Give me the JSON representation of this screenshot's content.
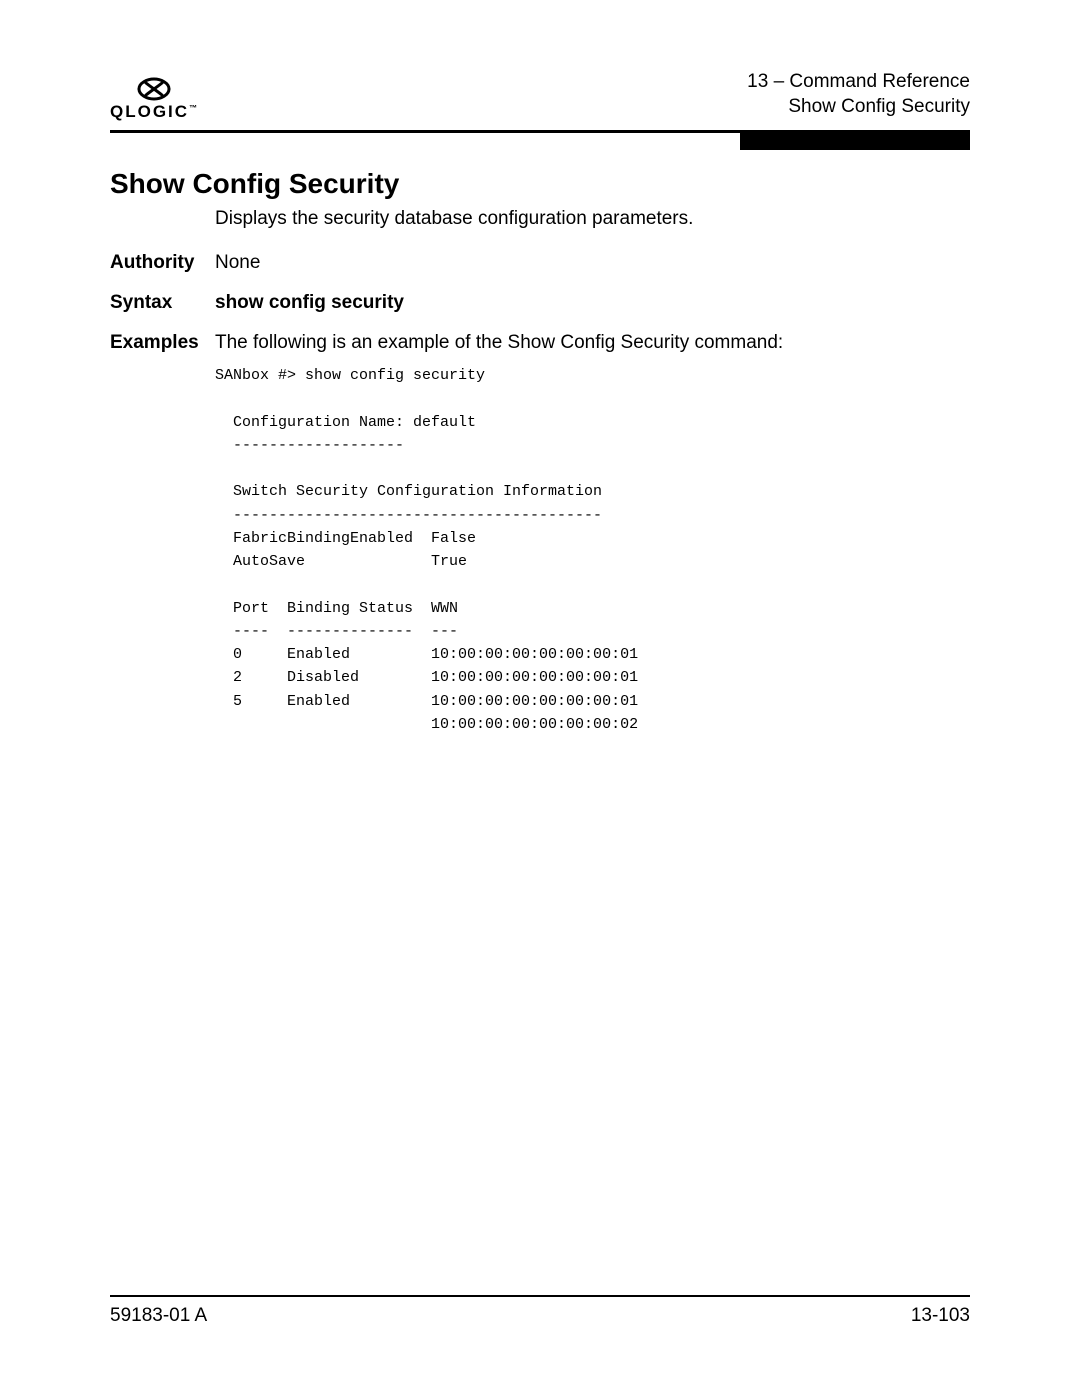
{
  "header": {
    "chapter_line": "13 – Command Reference",
    "section_line": "Show Config Security",
    "logo_text": "QLOGIC"
  },
  "title": "Show Config Security",
  "subtitle": "Displays the security database configuration parameters.",
  "authority": {
    "label": "Authority",
    "value": "None"
  },
  "syntax": {
    "label": "Syntax",
    "value": "show config security"
  },
  "examples": {
    "label": "Examples",
    "intro": "The following is an example of the Show Config Security command:",
    "terminal": "SANbox #> show config security\n\n  Configuration Name: default\n  -------------------\n\n  Switch Security Configuration Information\n  -----------------------------------------\n  FabricBindingEnabled  False\n  AutoSave              True\n\n  Port  Binding Status  WWN\n  ----  --------------  ---\n  0     Enabled         10:00:00:00:00:00:00:01\n  2     Disabled        10:00:00:00:00:00:00:01\n  5     Enabled         10:00:00:00:00:00:00:01\n                        10:00:00:00:00:00:00:02"
  },
  "footer": {
    "doc_id": "59183-01 A",
    "page_num": "13-103"
  }
}
